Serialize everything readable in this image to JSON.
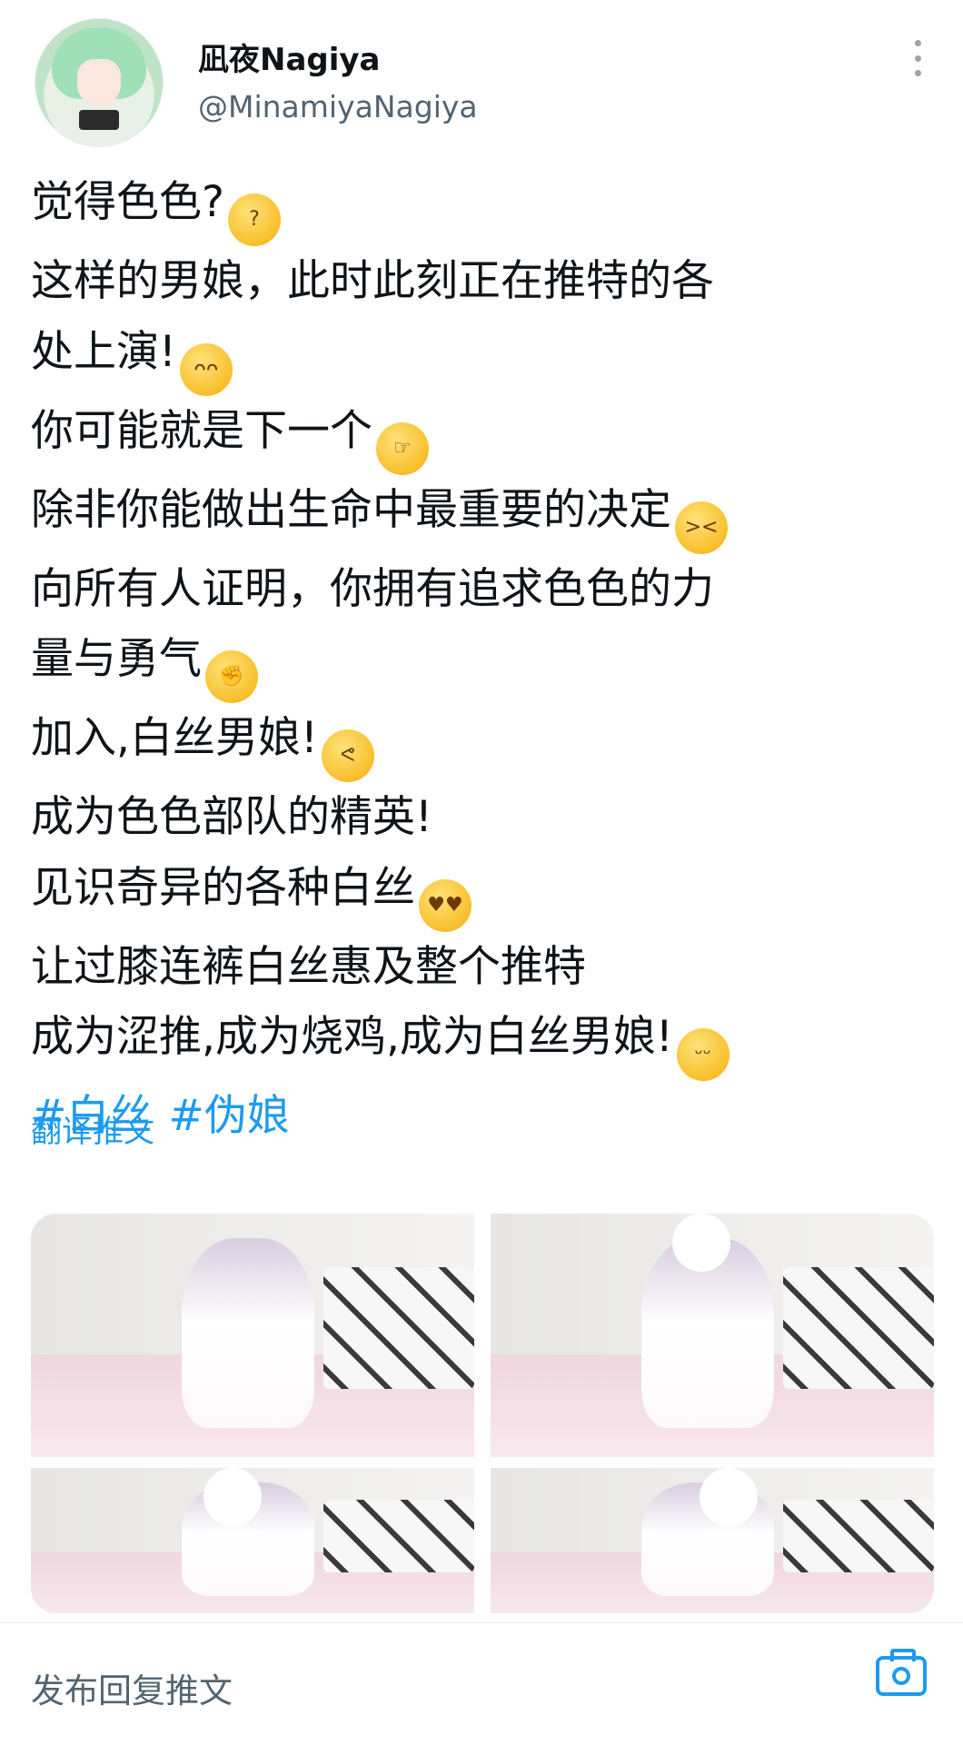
{
  "header": {
    "display_name": "凪夜Nagiya",
    "handle": "@MinamiyaNagiya",
    "avatar_icon": "anime-avatar-icon",
    "more_icon": "more-vertical-icon"
  },
  "tweet": {
    "lines": [
      {
        "text": "觉得色色?",
        "emoji": "thinking-face"
      },
      {
        "text": "这样的男娘，此时此刻正在推特的各"
      },
      {
        "text": "处上演!",
        "emoji": "anxious-face"
      },
      {
        "text": "你可能就是下一个",
        "emoji": "pointing-hand"
      },
      {
        "text": "除非你能做出生命中最重要的决定",
        "emoji": "steam-face"
      },
      {
        "text": "向所有人证明，你拥有追求色色的力"
      },
      {
        "text": "量与勇气",
        "emoji": "fist"
      },
      {
        "text": "加入,白丝男娘!",
        "emoji": "flexed-biceps"
      },
      {
        "text": "成为色色部队的精英!"
      },
      {
        "text": "见识奇异的各种白丝",
        "emoji": "heart-eyes"
      },
      {
        "text": "让过膝连裤白丝惠及整个推特"
      },
      {
        "text": "成为涩推,成为烧鸡,成为白丝男娘!",
        "emoji": "drooling-face"
      }
    ],
    "hashtags": [
      "#白丝",
      "#伪娘"
    ],
    "translate_label": "翻译推文"
  },
  "media": {
    "count": 4
  },
  "reply": {
    "placeholder": "发布回复推文",
    "camera_icon": "camera-icon"
  },
  "colors": {
    "link": "#1d9bf0",
    "text": "#0f1419",
    "secondary": "#536471"
  }
}
